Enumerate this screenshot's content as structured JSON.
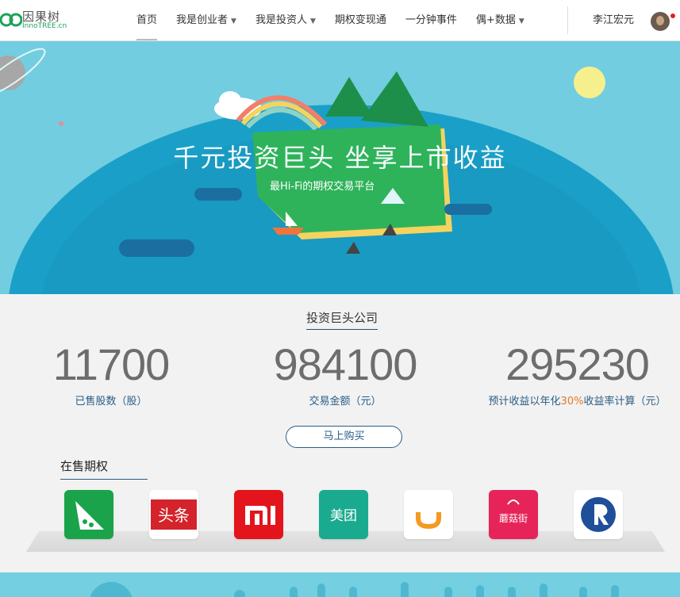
{
  "logo": {
    "cn": "因果树",
    "en": "InnoTREE.cn"
  },
  "nav": {
    "items": [
      {
        "label": "首页",
        "dropdown": false,
        "active": true
      },
      {
        "label": "我是创业者",
        "dropdown": true
      },
      {
        "label": "我是投资人",
        "dropdown": true
      },
      {
        "label": "期权变现通",
        "dropdown": false
      },
      {
        "label": "一分钟事件",
        "dropdown": false
      },
      {
        "label": "偶+数据",
        "dropdown": true
      }
    ],
    "caret": "▼",
    "user_name": "李江宏元"
  },
  "hero": {
    "title": "千元投资巨头 坐享上市收益",
    "subtitle": "最Hi-Fi的期权交易平台"
  },
  "stats": {
    "section_title": "投资巨头公司",
    "items": [
      {
        "value": "11700",
        "label": "已售股数（股）"
      },
      {
        "value": "984100",
        "label": "交易金额（元）"
      },
      {
        "value": "295230",
        "label_pre": "预计收益以年化",
        "label_hl": "30%",
        "label_post": "收益率计算（元）"
      }
    ],
    "buy_button": "马上购买"
  },
  "on_sale": {
    "title": "在售期权",
    "companies": [
      {
        "name": "豌豆荚",
        "icon": "wandoujia-icon",
        "color": "#1aa34a"
      },
      {
        "name": "头条",
        "icon": "toutiao-icon",
        "color": "#d4232b"
      },
      {
        "name": "小米",
        "icon": "xiaomi-icon",
        "color": "#e3141b"
      },
      {
        "name": "美团",
        "icon": "meituan-icon",
        "color": "#1aaa8f"
      },
      {
        "name": "滴滴",
        "icon": "didi-icon",
        "color": "#f39a20"
      },
      {
        "name": "蘑菇街",
        "icon": "mogujie-icon",
        "color": "#e6245a"
      },
      {
        "name": "R",
        "icon": "r-logo-icon",
        "color": "#1f4f9a"
      }
    ]
  }
}
